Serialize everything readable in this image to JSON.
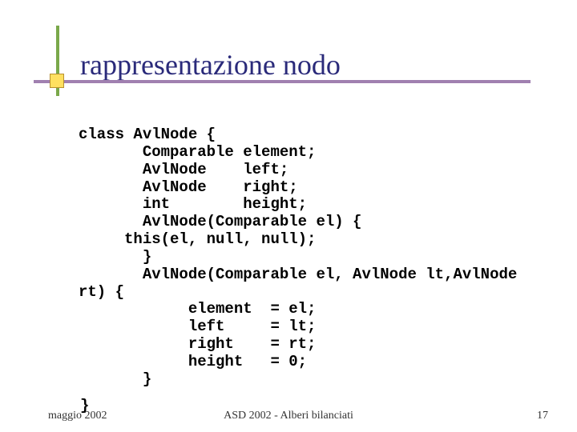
{
  "title": "rappresentazione nodo",
  "code": "class AvlNode {\n       Comparable element;\n       AvlNode    left;\n       AvlNode    right;\n       int        height;\n       AvlNode(Comparable el) {\n     this(el, null, null);\n       }\n       AvlNode(Comparable el, AvlNode lt,AvlNode\nrt) {\n            element  = el;\n            left     = lt;\n            right    = rt;\n            height   = 0;\n       }",
  "closing_brace": "}",
  "footer": {
    "left": "maggio 2002",
    "center": "ASD 2002 - Alberi bilanciati",
    "right": "17"
  }
}
